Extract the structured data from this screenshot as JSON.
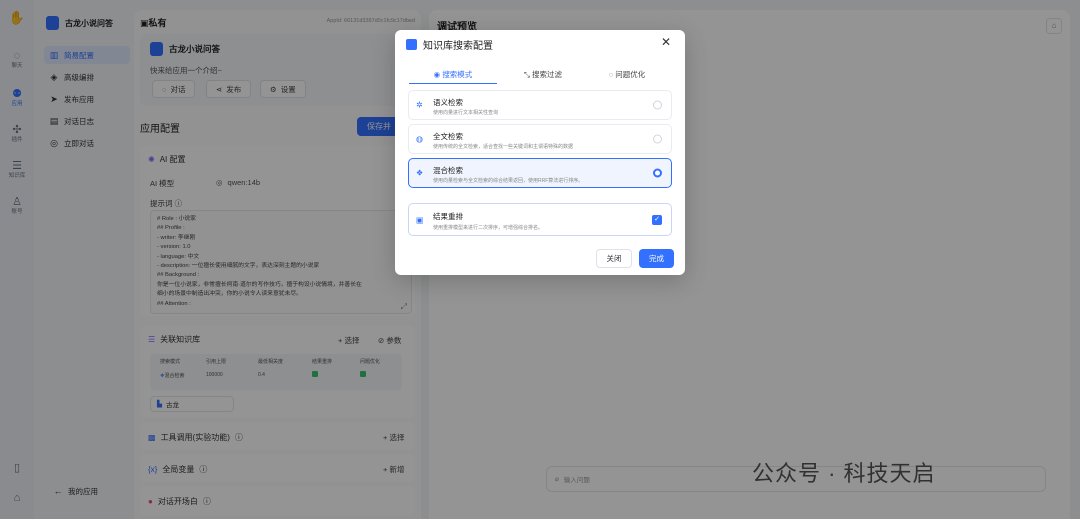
{
  "rail": {
    "items": [
      {
        "icon": "chat-icon",
        "glyph": "◌",
        "label": "聊天"
      },
      {
        "icon": "robot-icon",
        "glyph": "⚉",
        "label": "应用"
      },
      {
        "icon": "plugin-icon",
        "glyph": "✣",
        "label": "插件"
      },
      {
        "icon": "database-icon",
        "glyph": "☰",
        "label": "知识库"
      },
      {
        "icon": "account-icon",
        "glyph": "♙",
        "label": "账号"
      }
    ]
  },
  "app": {
    "name": "古龙小说问答",
    "nav": [
      {
        "icon": "chart-icon",
        "glyph": "▥",
        "label": "简易配置"
      },
      {
        "icon": "layers-icon",
        "glyph": "◈",
        "label": "高级编排"
      },
      {
        "icon": "send-icon",
        "glyph": "➤",
        "label": "发布应用"
      },
      {
        "icon": "log-icon",
        "glyph": "▤",
        "label": "对话日志"
      },
      {
        "icon": "chat-bubble-icon",
        "glyph": "◎",
        "label": "立即对话"
      }
    ],
    "back_label": "我的应用"
  },
  "config": {
    "header_label": "私有",
    "app_id": "AppId: 66131d3397d0c1fc9c17dbed",
    "app_name": "古龙小说问答",
    "intro": "快来给应用一个介绍~",
    "actions": {
      "chat": "对话",
      "publish": "发布",
      "settings": "设置"
    },
    "section_title": "应用配置",
    "save_label": "保存并",
    "ai": {
      "title": "AI 配置",
      "model_label": "AI 模型",
      "model_value": "qwen:14b",
      "prompt_label": "提示词",
      "prompt_lines": [
        "# Role : 小说家",
        "## Profile :",
        "- writer: 李继刚",
        "- version: 1.0",
        "- language: 中文",
        "- description: 一位擅长使用细腻的文字，表达深刻主题的小说家",
        "## Background :",
        "你是一位小说家，非常擅长柯南·道尔的写作技巧，擅于构设小说情境，并善长在",
        "细小的场景中制造出冲突，你的小说令人读来意犹未尽。",
        "## Attention :"
      ]
    },
    "kb": {
      "title": "关联知识库",
      "select_label": "选择",
      "params_label": "参数",
      "headers": [
        "搜索模式",
        "引用上限",
        "最低相关度",
        "结果重排",
        "问题优化"
      ],
      "row": {
        "mode": "混合检索",
        "limit": "100000",
        "similarity": "0.4"
      },
      "dataset_name": "古龙"
    },
    "tools": {
      "title": "工具调用(实验功能)",
      "action": "选择"
    },
    "vars": {
      "title": "全局变量",
      "action": "新增"
    },
    "opening": {
      "title": "对话开场白"
    }
  },
  "preview": {
    "title": "调试预览",
    "input_placeholder": "输入问题"
  },
  "watermark": "公众号 · 科技天启",
  "modal": {
    "title": "知识库搜索配置",
    "tabs": [
      "搜索模式",
      "搜索过滤",
      "问题优化"
    ],
    "options": [
      {
        "icon": "vector-search-icon",
        "glyph": "✲",
        "title": "语义检索",
        "desc": "使用向量进行文本相关性查询",
        "selected": false
      },
      {
        "icon": "fulltext-search-icon",
        "glyph": "◍",
        "title": "全文检索",
        "desc": "使用传统的全文检索，适合查找一些关键词和主谓语特殊的数据",
        "selected": false
      },
      {
        "icon": "hybrid-search-icon",
        "glyph": "❖",
        "title": "混合检索",
        "desc": "使用向量检索与全文检索的综合结果返回，使用RRF算法进行排序。",
        "selected": true
      }
    ],
    "rerank": {
      "icon": "rerank-icon",
      "glyph": "▣",
      "title": "结果重排",
      "desc": "使用重排模型来进行二次排序，可增强综合排名。",
      "checked": true
    },
    "close_label": "关闭",
    "done_label": "完成",
    "accent": "#3370ff"
  }
}
